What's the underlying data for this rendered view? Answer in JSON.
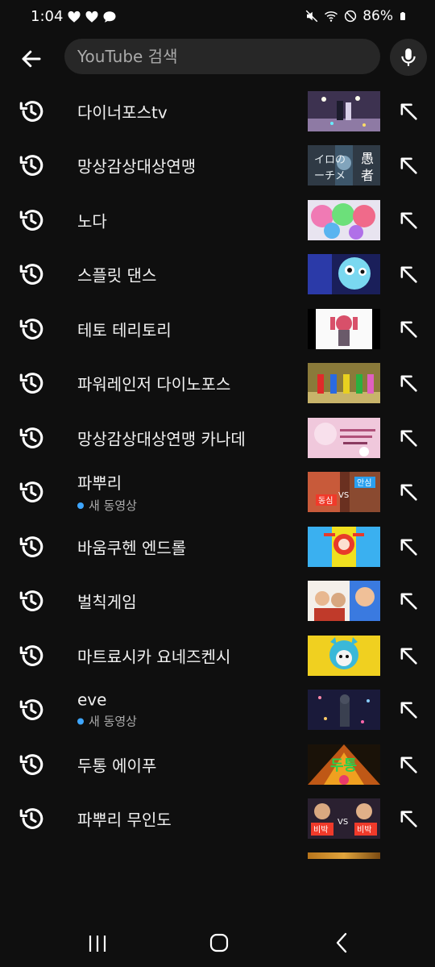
{
  "status": {
    "time": "1:04",
    "notifications": [
      "heart-icon",
      "heart-icon",
      "chat-bubble-icon"
    ],
    "battery": "86%",
    "icons": [
      "mute-icon",
      "wifi-icon",
      "do-not-disturb-icon",
      "battery-icon"
    ]
  },
  "search": {
    "placeholder": "YouTube 검색",
    "value": ""
  },
  "suggestions": [
    {
      "label": "다이너포스tv",
      "sub": ""
    },
    {
      "label": "망상감상대상연맹",
      "sub": ""
    },
    {
      "label": "노다",
      "sub": ""
    },
    {
      "label": "스플릿 댄스",
      "sub": ""
    },
    {
      "label": "테토 테리토리",
      "sub": ""
    },
    {
      "label": "파워레인저 다이노포스",
      "sub": ""
    },
    {
      "label": "망상감상대상연맹 카나데",
      "sub": ""
    },
    {
      "label": "파뿌리",
      "sub": "새 동영상"
    },
    {
      "label": "바움쿠헨 엔드롤",
      "sub": ""
    },
    {
      "label": "벌칙게임",
      "sub": ""
    },
    {
      "label": "마트료시카 요네즈켄시",
      "sub": ""
    },
    {
      "label": "eve",
      "sub": "새 동영상"
    },
    {
      "label": "두통 에이푸",
      "sub": ""
    },
    {
      "label": "파뿌리 무인도",
      "sub": ""
    }
  ],
  "thumbnail_text": {
    "t2_a": "イロの",
    "t2_b": "ーチメ",
    "t2_c": "愚",
    "t2_d": "者",
    "t8_a": "동심",
    "t8_b": "VS",
    "t8_c": "안심",
    "t14_a": "비박",
    "t14_b": "VS",
    "t14_c": "비박",
    "t13": "두통"
  },
  "colors": {
    "background": "#0f0f0f",
    "search_field": "#272727",
    "new_video_dot": "#3ea6ff",
    "text_primary": "#f1f1f1",
    "text_secondary": "#aaaaaa"
  },
  "navigation": [
    "recent-apps-icon",
    "home-icon",
    "back-icon"
  ]
}
